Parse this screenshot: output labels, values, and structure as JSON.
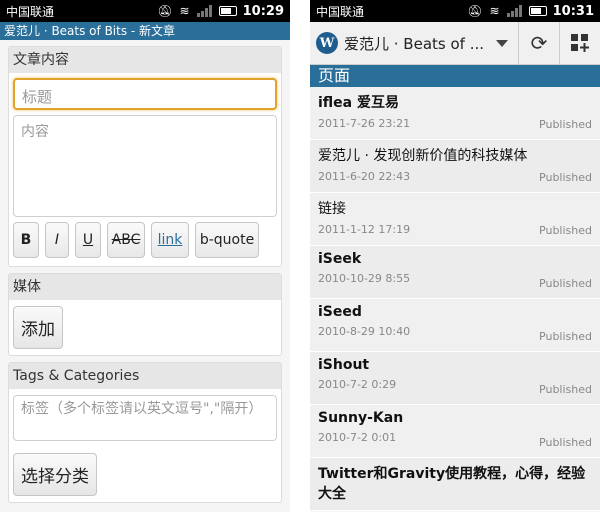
{
  "left": {
    "status": {
      "carrier": "中国联通",
      "time": "10:29"
    },
    "title_bar": "爱范儿 · Beats of Bits - 新文章",
    "content_section": {
      "header": "文章内容",
      "title_placeholder": "标题",
      "content_placeholder": "内容",
      "format_buttons": [
        "B",
        "I",
        "U",
        "ABC",
        "link",
        "b-quote"
      ]
    },
    "media_section": {
      "header": "媒体",
      "add_label": "添加"
    },
    "tags_section": {
      "header": "Tags & Categories",
      "tags_placeholder": "标签（多个标签请以英文逗号\",\"隔开）",
      "choose_category_label": "选择分类"
    }
  },
  "right": {
    "status": {
      "carrier": "中国联通",
      "time": "10:31"
    },
    "app_bar": {
      "logo": "W",
      "site_title": "爱范儿 · Beats of ...",
      "refresh_icon": "refresh-icon",
      "add_icon": "add-post-icon"
    },
    "section_header": "页面",
    "pages": [
      {
        "title": "iflea 爱互易",
        "date": "2011-7-26 23:21",
        "status": "Published"
      },
      {
        "title": "爱范儿 · 发现创新价值的科技媒体",
        "date": "2011-6-20 22:43",
        "status": "Published"
      },
      {
        "title": "链接",
        "date": "2011-1-12 17:19",
        "status": "Published"
      },
      {
        "title": "iSeek",
        "date": "2010-10-29 8:55",
        "status": "Published"
      },
      {
        "title": "iSeed",
        "date": "2010-8-29 10:40",
        "status": "Published"
      },
      {
        "title": "iShout",
        "date": "2010-7-2 0:29",
        "status": "Published"
      },
      {
        "title": "Sunny-Kan",
        "date": "2010-7-2 0:01",
        "status": "Published"
      },
      {
        "title": "Twitter和Gravity使用教程，心得，经验大全",
        "date": "",
        "status": ""
      }
    ]
  }
}
